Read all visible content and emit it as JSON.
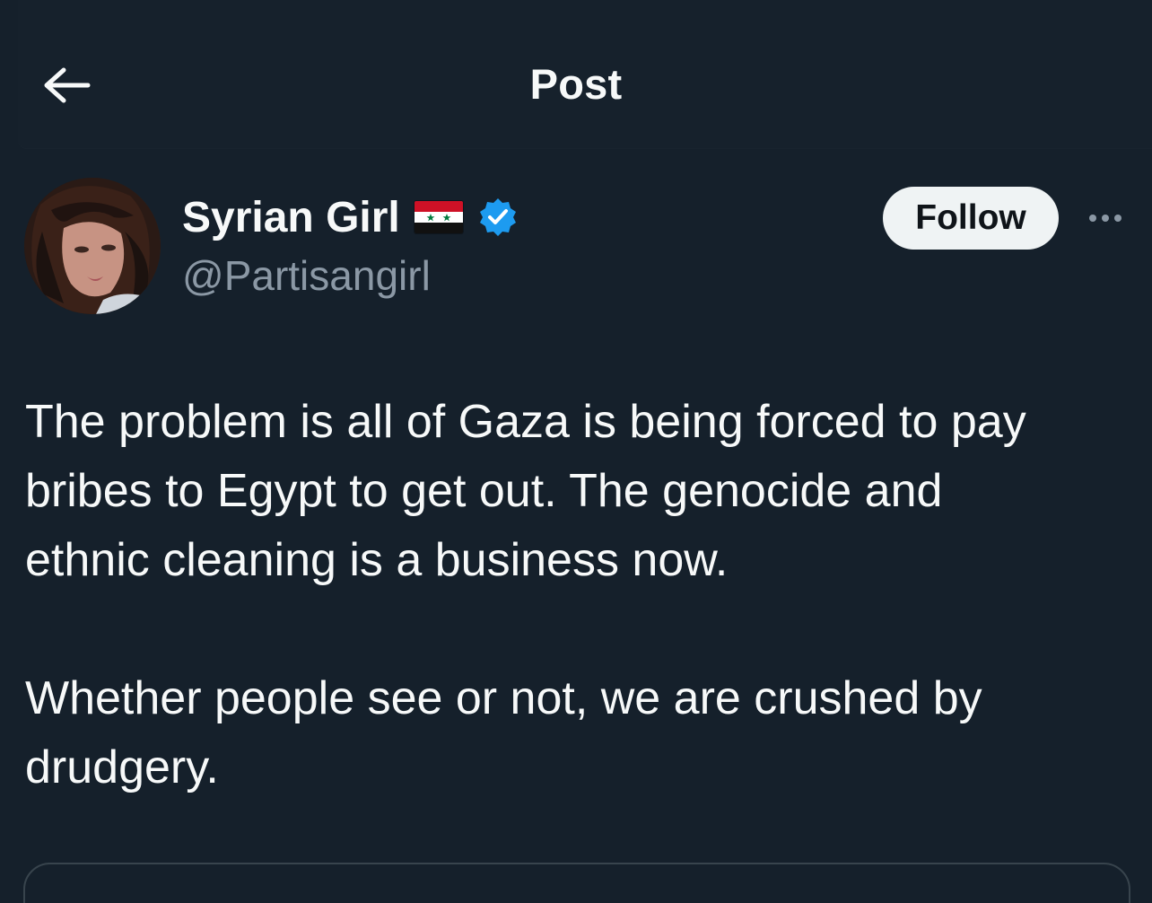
{
  "header": {
    "title": "Post",
    "back_icon": "arrow-left-icon"
  },
  "author": {
    "display_name": "Syrian Girl",
    "handle": "@Partisangirl",
    "flag_icon": "syria-flag-icon",
    "verified_icon": "verified-badge-icon",
    "verified_color": "#1d9bf0"
  },
  "actions": {
    "follow_label": "Follow",
    "more_icon": "more-horizontal-icon"
  },
  "post": {
    "text": "The problem is all of Gaza is being forced to pay\nbribes to Egypt to get out. The genocide and\nethnic cleaning is a business now.\n\nWhether people see or not, we are crushed by\ndrudgery."
  },
  "colors": {
    "background": "#15202b",
    "text_primary": "#f7f9f9",
    "text_secondary": "#8b98a5",
    "button_bg": "#eff3f4",
    "border": "#38444d"
  }
}
